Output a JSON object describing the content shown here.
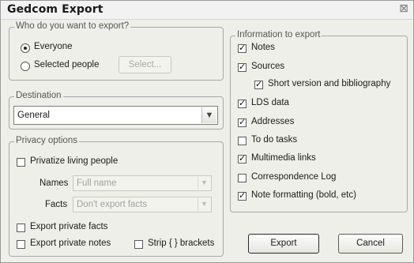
{
  "window": {
    "title": "Gedcom Export",
    "close_glyph": "⊠"
  },
  "who": {
    "legend": "Who do you want to export?",
    "everyone_label": "Everyone",
    "everyone_selected": true,
    "selected_people_label": "Selected people",
    "select_button": "Select..."
  },
  "destination": {
    "legend": "Destination",
    "value": "General"
  },
  "privacy": {
    "legend": "Privacy options",
    "privatize_label": "Privatize living people",
    "privatize_checked": false,
    "names_label": "Names",
    "names_value": "Full name",
    "facts_label": "Facts",
    "facts_value": "Don't export facts",
    "export_private_facts_label": "Export private facts",
    "export_private_notes_label": "Export private notes",
    "strip_brackets_label": "Strip { } brackets"
  },
  "info": {
    "legend": "Information to export",
    "items": [
      {
        "label": "Notes",
        "checked": true
      },
      {
        "label": "Sources",
        "checked": true
      },
      {
        "label": "Short version and bibliography",
        "checked": true
      },
      {
        "label": "LDS data",
        "checked": true
      },
      {
        "label": "Addresses",
        "checked": true
      },
      {
        "label": "To do tasks",
        "checked": false
      },
      {
        "label": "Multimedia links",
        "checked": true
      },
      {
        "label": "Correspondence Log",
        "checked": false
      },
      {
        "label": "Note formatting (bold, etc)",
        "checked": true
      }
    ]
  },
  "buttons": {
    "export": "Export",
    "cancel": "Cancel"
  }
}
